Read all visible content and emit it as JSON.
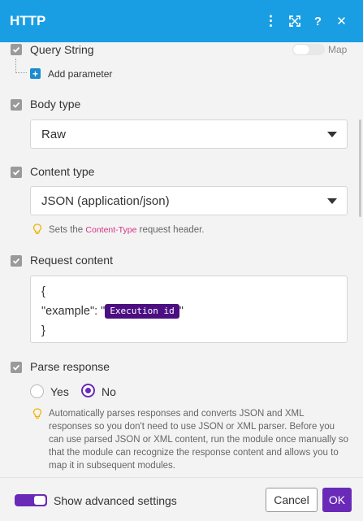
{
  "header": {
    "title": "HTTP",
    "icons": [
      "more-vertical-icon",
      "expand-icon",
      "help-icon",
      "close-icon"
    ],
    "icon_glyphs": {
      "more": "⋮",
      "help": "?",
      "close": "✕"
    },
    "color": "#1a9ee3"
  },
  "query_string": {
    "label": "Query String",
    "map_label": "Map",
    "add_parameter": "Add parameter"
  },
  "body_type": {
    "label": "Body type",
    "value": "Raw"
  },
  "content_type": {
    "label": "Content type",
    "value": "JSON (application/json)",
    "hint_prefix": "Sets the ",
    "hint_code": "Content-Type",
    "hint_suffix": " request header."
  },
  "request_content": {
    "label": "Request content",
    "line1": "{",
    "line2_prefix": "\"example\": \"",
    "pill": "Execution id",
    "line2_suffix": "\"",
    "line3": "}"
  },
  "parse_response": {
    "label": "Parse response",
    "options": [
      "Yes",
      "No"
    ],
    "selected": "No",
    "hint": "Automatically parses responses and converts JSON and XML responses so you don't need to use JSON or XML parser. Before you can use parsed JSON or XML content, run the module once manually so that the module can recognize the response content and allows you to map it in subsequent modules."
  },
  "footer": {
    "advanced_label": "Show advanced settings",
    "advanced_on": true,
    "cancel_label": "Cancel",
    "ok_label": "OK"
  },
  "colors": {
    "accent": "#6a2ab8",
    "pill": "#4b0f82",
    "code": "#d63384"
  }
}
